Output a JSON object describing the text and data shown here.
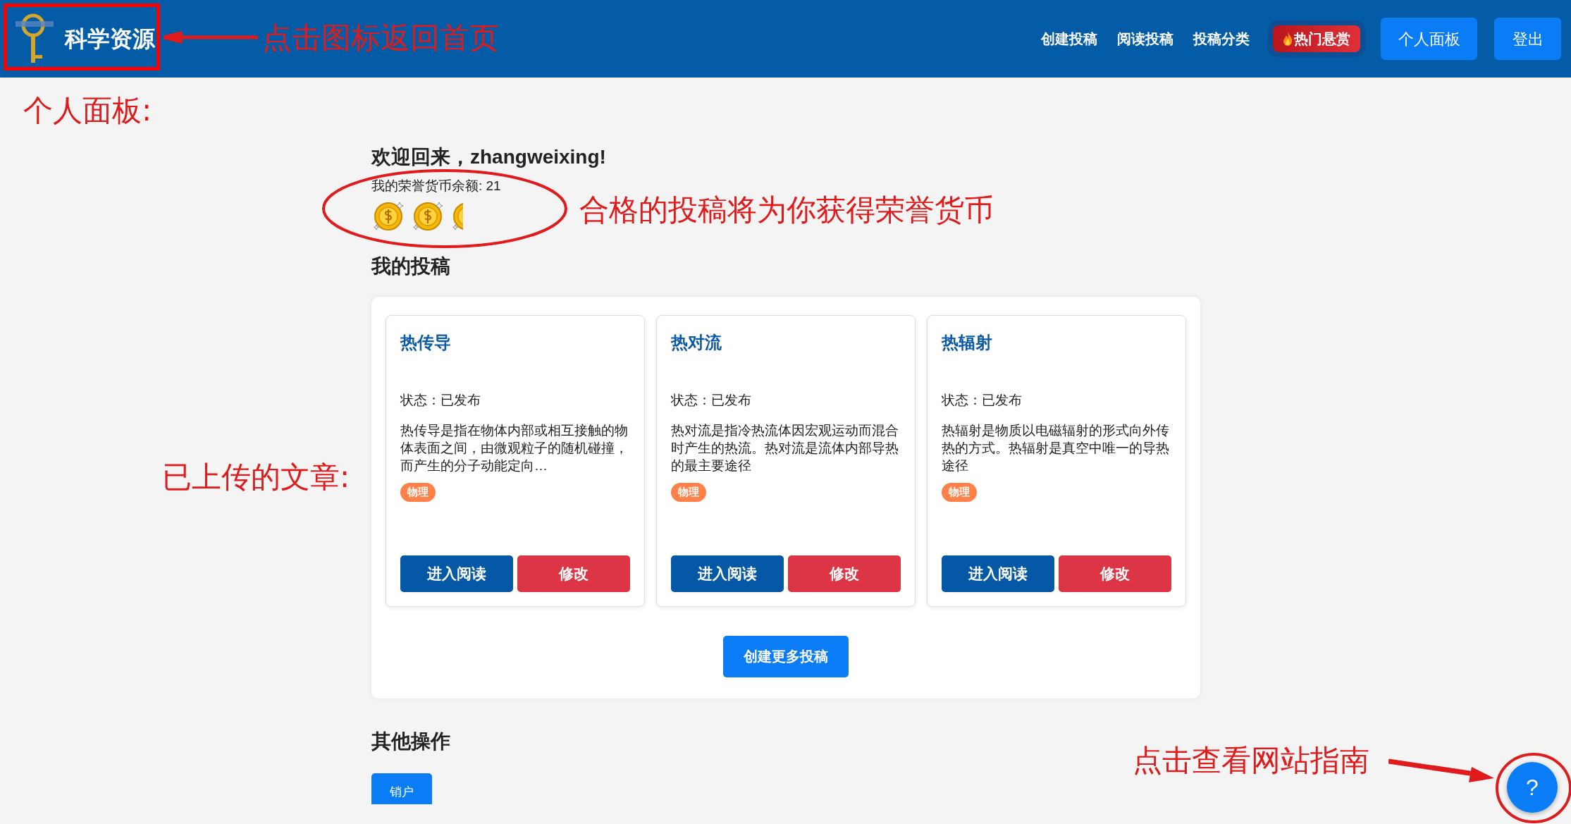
{
  "header": {
    "logo_text": "科学资源",
    "nav_links": [
      "创建投稿",
      "阅读投稿",
      "投稿分类"
    ],
    "hot_button": "热门悬赏",
    "buttons": [
      "个人面板",
      "登出"
    ]
  },
  "welcome": {
    "title": "欢迎回来，zhangweixing!",
    "balance": "我的荣誉货币余额: 21"
  },
  "my_posts": {
    "heading": "我的投稿",
    "cards": [
      {
        "title": "热传导",
        "status": "状态：已发布",
        "description": "热传导是指在物体内部或相互接触的物体表面之间，由微观粒子的随机碰撞，而产生的分子动能定向…",
        "tags": [
          "物理"
        ],
        "actions": [
          "进入阅读",
          "修改"
        ]
      },
      {
        "title": "热对流",
        "status": "状态：已发布",
        "description": "热对流是指冷热流体因宏观运动而混合时产生的热流。热对流是流体内部导热的最主要途径",
        "tags": [
          "物理"
        ],
        "actions": [
          "进入阅读",
          "修改"
        ]
      },
      {
        "title": "热辐射",
        "status": "状态：已发布",
        "description": "热辐射是物质以电磁辐射的形式向外传热的方式。热辐射是真空中唯一的导热途径",
        "tags": [
          "物理"
        ],
        "actions": [
          "进入阅读",
          "修改"
        ]
      }
    ],
    "create_more": "创建更多投稿"
  },
  "other": {
    "heading": "其他操作",
    "buttons": [
      "销户"
    ]
  },
  "help_button": "?",
  "annotations": [
    "点击图标返回首页",
    "个人面板:",
    "合格的投稿将为你获得荣誉货币",
    "已上传的文章:",
    "点击查看网站指南"
  ]
}
